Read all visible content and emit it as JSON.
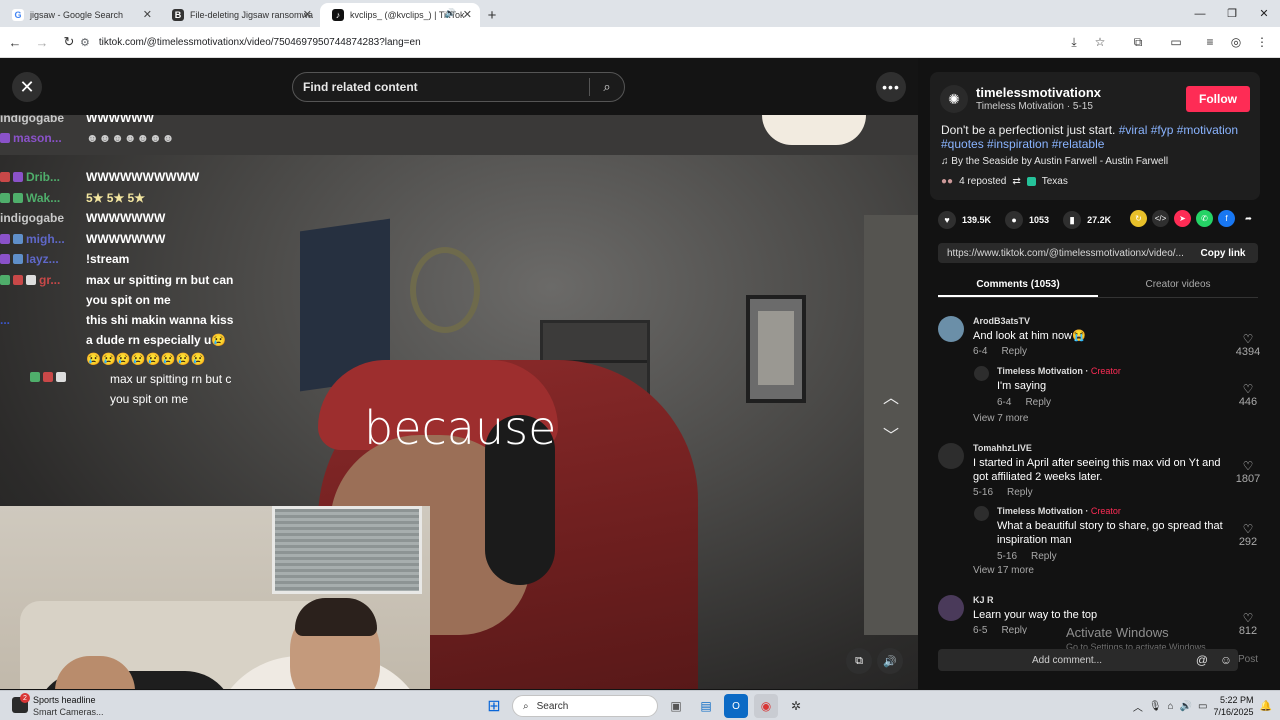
{
  "browser": {
    "tabs": [
      {
        "title": "jigsaw - Google Search",
        "favicon": "G",
        "active": false
      },
      {
        "title": "File-deleting Jigsaw ransomwa",
        "favicon": "B",
        "active": false
      },
      {
        "title": "kvclips_ (@kvclips_) | TikTok",
        "favicon": "♪",
        "active": true
      }
    ],
    "url": "tiktok.com/@timelessmotivationx/video/7504697950744874283?lang=en"
  },
  "player": {
    "search_placeholder": "Find related content",
    "caption": "because",
    "chat": [
      {
        "user": "indigogabe",
        "user_color": "#c9c9c9",
        "message": "WWWWWW"
      },
      {
        "user": "mason...",
        "user_color": "#8a52c9",
        "message": "☻☻☻☻☻☻☻"
      },
      {
        "user": "Drib...",
        "user_color": "#4fae6b",
        "message": "WWWWWWWWWW"
      },
      {
        "user": "Wak...",
        "user_color": "#4fae6b",
        "message": "5★ 5★ 5★"
      },
      {
        "user": "indigogabe",
        "user_color": "#c9c9c9",
        "message": "WWWWWWW"
      },
      {
        "user": "migh...",
        "user_color": "#5f68c9",
        "message": "WWWWWWW"
      },
      {
        "user": "layz...",
        "user_color": "#5f68c9",
        "message": "!stream"
      },
      {
        "user": "gr...",
        "user_color": "#c94848",
        "message": "max ur spitting rn but can"
      },
      {
        "user": "",
        "user_color": "#c94848",
        "message": "you spit on me"
      },
      {
        "user": "...",
        "user_color": "#3b55c9",
        "message": "this shi makin wanna kiss"
      },
      {
        "user": "",
        "user_color": "#3b55c9",
        "message": "a dude rn especially u😢"
      },
      {
        "user": "",
        "user_color": "#3b55c9",
        "message": "😢😢😢😢😢😢😢😢"
      },
      {
        "user": "",
        "user_color": "#c94848",
        "message": "max ur spitting rn but c"
      },
      {
        "user": "",
        "user_color": "#c94848",
        "message": "you spit on me"
      }
    ]
  },
  "panel": {
    "username": "timelessmotivationx",
    "subline": "Timeless Motivation · 5-15",
    "follow_label": "Follow",
    "description_text": "Don't be a perfectionist just start.",
    "description_tags": "#viral #fyp #motivation #quotes #inspiration #relatable",
    "music": "By the Seaside by Austin Farwell - Austin Farwell",
    "reposted": "4 reposted",
    "location": "Texas",
    "likes": "139.5K",
    "comments_count": "1053",
    "saves": "27.2K",
    "link": "https://www.tiktok.com/@timelessmotivationx/video/...",
    "copy_link": "Copy link",
    "tab_comments": "Comments (1053)",
    "tab_creator": "Creator videos",
    "comments": [
      {
        "user": "ArodB3atsTV",
        "text": "And look at him now😭",
        "date": "6-4",
        "reply": "Reply",
        "likes": "4394"
      },
      {
        "user": "Timeless Motivation",
        "creator_tag": "Creator",
        "text": "I'm saying",
        "date": "6-4",
        "reply": "Reply",
        "likes": "446"
      },
      {
        "user": "TomahhzLIVE",
        "text": "I started in April after seeing this max vid on Yt and got affiliated 2 weeks later.",
        "date": "5-16",
        "reply": "Reply",
        "likes": "1807"
      },
      {
        "user": "Timeless Motivation",
        "creator_tag": "Creator",
        "text": "What a beautiful story to share, go spread that inspiration man",
        "date": "5-16",
        "reply": "Reply",
        "likes": "292"
      },
      {
        "user": "KJ R",
        "text": "Learn your way to the top",
        "date": "6-5",
        "reply": "Reply",
        "likes": "812"
      }
    ],
    "view_more_1": "View 7 more",
    "view_more_2": "View 17 more",
    "activate_title": "Activate Windows",
    "activate_sub": "Go to Settings to activate Windows.",
    "add_comment": "Add comment...",
    "post": "Post"
  },
  "taskbar": {
    "news_title": "Sports headline",
    "news_sub": "Smart Cameras...",
    "badge": "2",
    "search": "Search",
    "time": "5:22 PM",
    "date": "7/16/2025"
  }
}
